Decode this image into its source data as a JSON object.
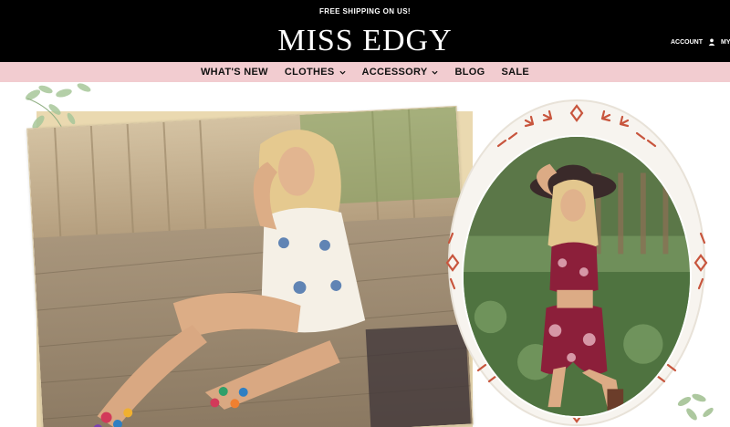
{
  "header": {
    "promo_text": "FREE SHIPPING ON US!",
    "logo_text": "MISS EDGY",
    "account_label": "ACCOUNT",
    "my_label": "MY"
  },
  "nav": {
    "items": [
      {
        "label": "WHAT'S NEW",
        "has_dropdown": false
      },
      {
        "label": "CLOTHES",
        "has_dropdown": true
      },
      {
        "label": "ACCESSORY",
        "has_dropdown": true
      },
      {
        "label": "BLOG",
        "has_dropdown": false
      },
      {
        "label": "SALE",
        "has_dropdown": false
      }
    ]
  },
  "colors": {
    "topbar": "#000000",
    "nav_background": "#f2ccd0",
    "frame_background": "#ead9b0",
    "ornament": "#c8553d",
    "leaf": "#9fbf8f"
  },
  "icons": {
    "account": "person-icon",
    "dropdown": "chevron-down-icon"
  }
}
